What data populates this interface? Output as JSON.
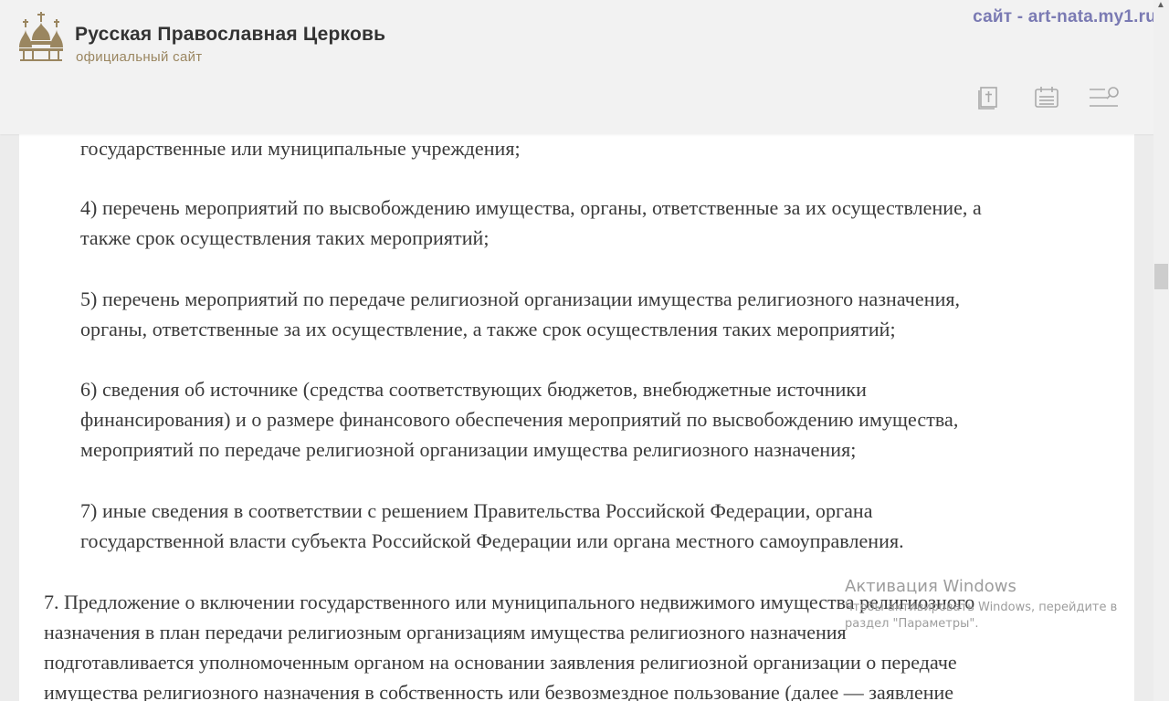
{
  "header": {
    "title": "Русская Православная Церковь",
    "subtitle": "официальный сайт",
    "watermark": "сайт  - art-nata.my1.ru",
    "icons": [
      "bible-icon",
      "calendar-icon",
      "menu-search-icon"
    ]
  },
  "article": {
    "lines_prev": "государственные или муниципальные учреждения;",
    "items": [
      {
        "lines": [
          "4) перечень мероприятий по высвобождению имущества, органы, ответственные за их осуществление, а",
          "также срок осуществления таких мероприятий;"
        ]
      },
      {
        "lines": [
          "5) перечень мероприятий по передаче религиозной организации имущества религиозного назначения,",
          "органы, ответственные за их осуществление, а также срок осуществления таких мероприятий;"
        ]
      },
      {
        "lines": [
          "6) сведения об источнике (средства соответствующих бюджетов, внебюджетные источники",
          "финансирования) и о размере финансового обеспечения мероприятий по высвобождению имущества,",
          "мероприятий по передаче религиозной организации имущества религиозного назначения;"
        ]
      },
      {
        "lines": [
          "7) иные сведения в соответствии с решением Правительства Российской Федерации, органа",
          "государственной власти субъекта Российской Федерации или органа местного самоуправления."
        ]
      }
    ],
    "paragraph7": [
      "7. Предложение о включении государственного или муниципального недвижимого имущества религиозного",
      "назначения в план передачи религиозным организациям имущества религиозного назначения",
      "подготавливается уполномоченным органом на основании заявления религиозной организации о передаче",
      "имущества религиозного назначения в собственность или безвозмездное пользование (далее — заявление"
    ]
  },
  "activation": {
    "title": "Активация Windows",
    "line1": "Чтобы активировать Windows, перейдите в",
    "line2": "раздел \"Параметры\"."
  },
  "colors": {
    "accent": "#9a8660",
    "watermark": "#7a7ab3",
    "icon": "#a9a9a9"
  }
}
